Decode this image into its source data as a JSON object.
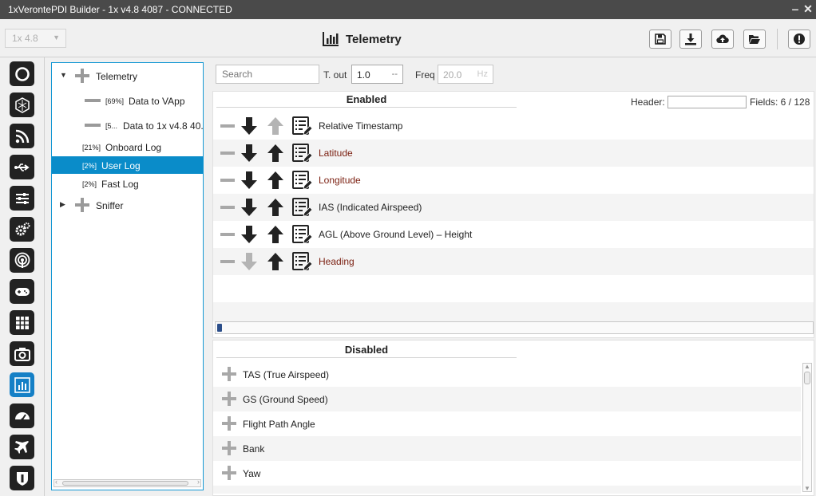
{
  "window": {
    "title": "1xVerontePDI Builder - 1x v4.8 4087 - CONNECTED",
    "minimize": "‒",
    "close": "✕"
  },
  "toolbar": {
    "version": "1x 4.8",
    "page_title": "Telemetry",
    "buttons": [
      "save-icon",
      "download-icon",
      "cloud-upload-icon",
      "folder-open-icon",
      "alert-icon"
    ]
  },
  "sidebar": {
    "icons": [
      "power-icon",
      "chip-icon",
      "rss-icon",
      "usb-icon",
      "sliders-icon",
      "gears-icon",
      "broadcast-icon",
      "gamepad-icon",
      "grid-icon",
      "camera-icon",
      "chart-icon",
      "gauge-icon",
      "plane-icon",
      "shield-icon"
    ],
    "active_index": 10
  },
  "tree": {
    "items": [
      {
        "prefix": "",
        "label": "Telemetry"
      },
      {
        "prefix": "[69%]",
        "label": "Data to VApp"
      },
      {
        "prefix": "[5...",
        "label": "Data to 1x v4.8 40..."
      },
      {
        "prefix": "[21%]",
        "label": "Onboard Log"
      },
      {
        "prefix": "[2%]",
        "label": "User Log"
      },
      {
        "prefix": "[2%]",
        "label": "Fast Log"
      },
      {
        "prefix": "",
        "label": "Sniffer"
      }
    ]
  },
  "filters": {
    "search_placeholder": "Search",
    "timeout_label": "T. out",
    "timeout_value": "1.0",
    "timeout_unit": "--",
    "freq_label": "Freq",
    "freq_value": "20.0",
    "freq_unit": "Hz"
  },
  "enabled": {
    "title": "Enabled",
    "header_label": "Header:",
    "header_value": "",
    "fields_text": "Fields: 6 / 128",
    "rows": [
      {
        "label": "Relative Timestamp",
        "warn": false,
        "up_enabled": false,
        "down_enabled": true
      },
      {
        "label": "Latitude",
        "warn": true,
        "up_enabled": true,
        "down_enabled": true
      },
      {
        "label": "Longitude",
        "warn": true,
        "up_enabled": true,
        "down_enabled": true
      },
      {
        "label": "IAS (Indicated Airspeed)",
        "warn": false,
        "up_enabled": true,
        "down_enabled": true
      },
      {
        "label": "AGL (Above Ground Level) – Height",
        "warn": false,
        "up_enabled": true,
        "down_enabled": true
      },
      {
        "label": "Heading",
        "warn": true,
        "up_enabled": true,
        "down_enabled": false
      }
    ]
  },
  "disabled": {
    "title": "Disabled",
    "rows": [
      {
        "label": "TAS (True Airspeed)"
      },
      {
        "label": "GS (Ground Speed)"
      },
      {
        "label": "Flight Path Angle"
      },
      {
        "label": "Bank"
      },
      {
        "label": "Yaw"
      }
    ]
  }
}
